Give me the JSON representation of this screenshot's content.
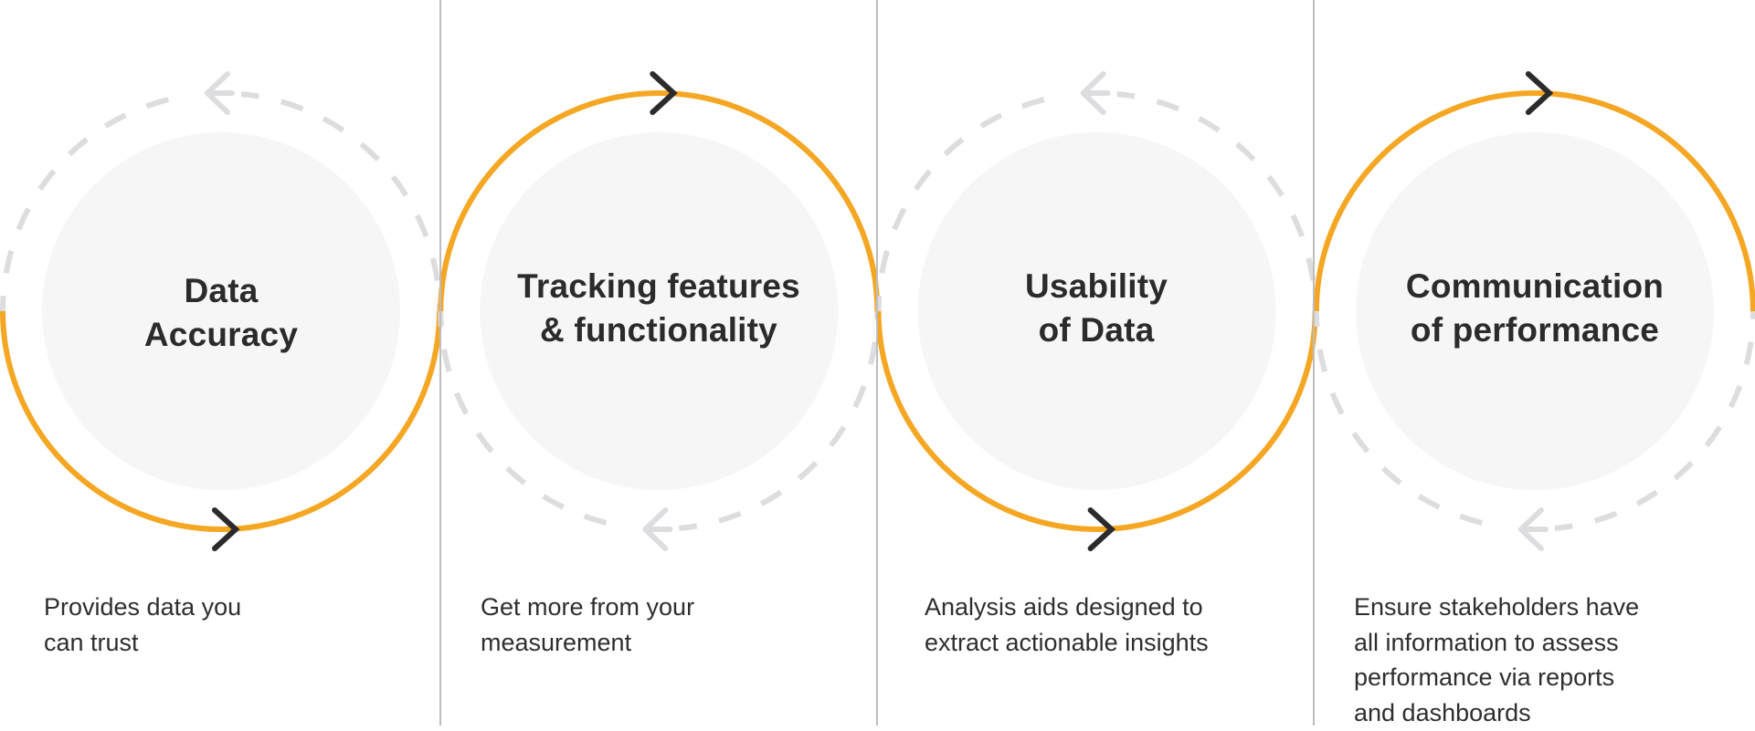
{
  "diagram": {
    "type": "process-cycle",
    "colors": {
      "active_arc": "#F5A623",
      "inactive_arc": "#DDDDE0",
      "inner_circle": "#F6F6F6",
      "chevron": "#2B2B2B",
      "divider": "#BDBDBD",
      "text": "#2B2B2B"
    },
    "steps": [
      {
        "title": "Data\nAccuracy",
        "description": "Provides data you\ncan trust",
        "active_half": "bottom",
        "active_arrow_icon": "chevron-right-icon",
        "inactive_arrow_icon": "arrow-left-icon"
      },
      {
        "title": "Tracking features\n& functionality",
        "description": "Get more from your\nmeasurement",
        "active_half": "top",
        "active_arrow_icon": "chevron-right-icon",
        "inactive_arrow_icon": "arrow-left-icon"
      },
      {
        "title": "Usability\nof Data",
        "description": "Analysis aids designed to\nextract actionable insights",
        "active_half": "bottom",
        "active_arrow_icon": "chevron-right-icon",
        "inactive_arrow_icon": "arrow-left-icon"
      },
      {
        "title": "Communication\nof performance",
        "description": "Ensure stakeholders have\nall information to assess\nperformance via reports\nand dashboards",
        "active_half": "top",
        "active_arrow_icon": "chevron-right-icon",
        "inactive_arrow_icon": "arrow-left-icon"
      }
    ]
  }
}
